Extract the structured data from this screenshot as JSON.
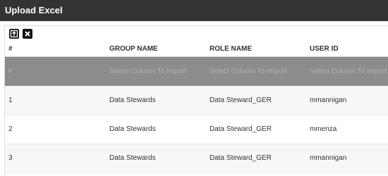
{
  "window": {
    "title": "Upload Excel"
  },
  "toolbar": {
    "upload_icon": "upload-icon",
    "close_icon": "close-icon"
  },
  "table": {
    "headers": [
      "#",
      "GROUP NAME",
      "ROLE NAME",
      "USER ID"
    ],
    "select_row": [
      "#",
      "Select Column To Import",
      "Select Column To Import",
      "Select Column To Import"
    ],
    "rows": [
      [
        "1",
        "Data Stewards",
        "Data Steward_GER",
        "mmannigan"
      ],
      [
        "2",
        "Data Stewards",
        "Data Steward_GER",
        "mmenza"
      ],
      [
        "3",
        "Data Stewards",
        "Data Steward_GER",
        "mmannigan"
      ]
    ]
  },
  "colors": {
    "titlebar": "#333333",
    "select_row_bg": "#8c8c8c",
    "zebra_row": "#f7f7f7"
  }
}
